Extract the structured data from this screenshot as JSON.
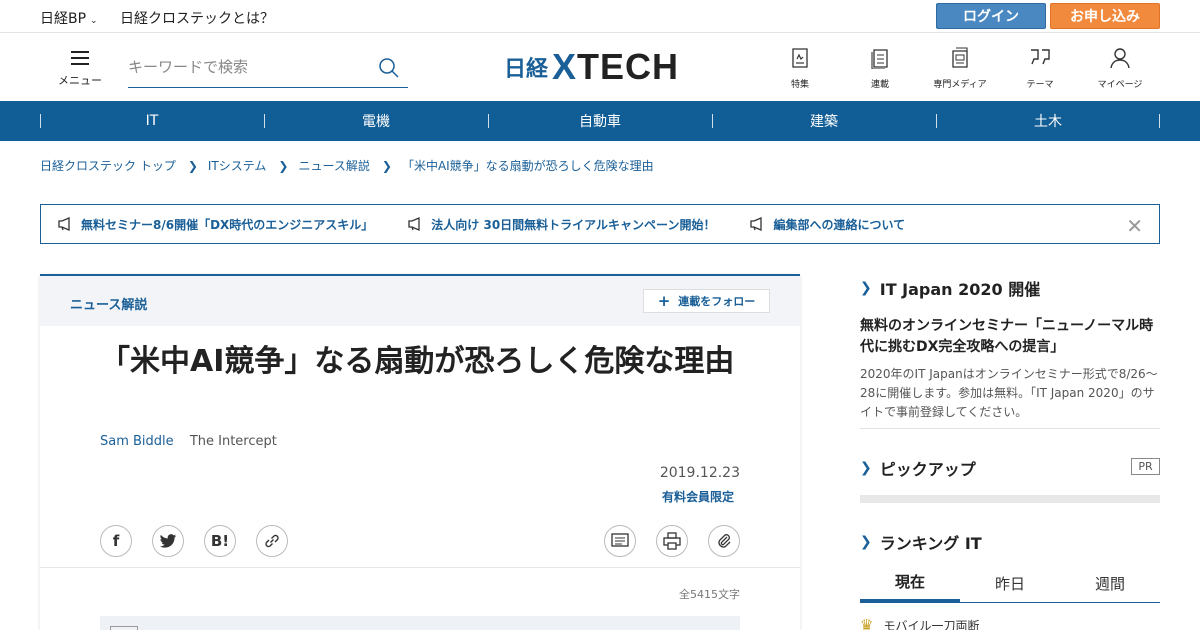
{
  "topbar": {
    "nikkei_bp": "日経BP",
    "about": "日経クロステックとは？",
    "login": "ログイン",
    "signup": "お申し込み"
  },
  "header": {
    "menu_label": "メニュー",
    "search_placeholder": "キーワードで検索",
    "logo_nikkei": "日経",
    "logo_xtech_x": "X",
    "logo_xtech_rest": "TECH",
    "nav": [
      {
        "label": "特集",
        "icon": "feature-icon"
      },
      {
        "label": "連載",
        "icon": "series-icon"
      },
      {
        "label": "専門メディア",
        "icon": "media-icon"
      },
      {
        "label": "テーマ",
        "icon": "theme-icon"
      },
      {
        "label": "マイページ",
        "icon": "user-icon"
      }
    ]
  },
  "categories": [
    "IT",
    "電機",
    "自動車",
    "建築",
    "土木"
  ],
  "breadcrumbs": [
    "日経クロステック トップ",
    "ITシステム",
    "ニュース解説",
    "「米中AI競争」なる扇動が恐ろしく危険な理由"
  ],
  "notices": [
    "無料セミナー8/6開催「DX時代のエンジニアスキル」",
    "法人向け 30日間無料トライアルキャンペーン開始！",
    "編集部への連絡について"
  ],
  "article": {
    "series": "ニュース解説",
    "follow": "連載をフォロー",
    "title": "「米中AI競争」なる扇動が恐ろしく危険な理由",
    "author": "Sam Biddle",
    "outlet": "The Intercept",
    "date": "2019.12.23",
    "paid": "有料会員限定",
    "share_hatena": "B!",
    "char_count": "全5415文字"
  },
  "sidebar": {
    "section1_title": "IT Japan 2020 開催",
    "promo_title": "無料のオンラインセミナー「ニューノーマル時代に挑むDX完全攻略への提言」",
    "promo_desc": "2020年のIT Japanはオンラインセミナー形式で8/26～28に開催します。参加は無料。「IT Japan 2020」のサイトで事前登録してください。",
    "section2_title": "ピックアップ",
    "pr": "PR",
    "section3_title": "ランキング IT",
    "tabs": [
      "現在",
      "昨日",
      "週間"
    ],
    "rank1": "モバイル一刀両断"
  },
  "colors": {
    "brand": "#115d96",
    "login": "#4a88c2",
    "signup": "#f28a3e"
  }
}
